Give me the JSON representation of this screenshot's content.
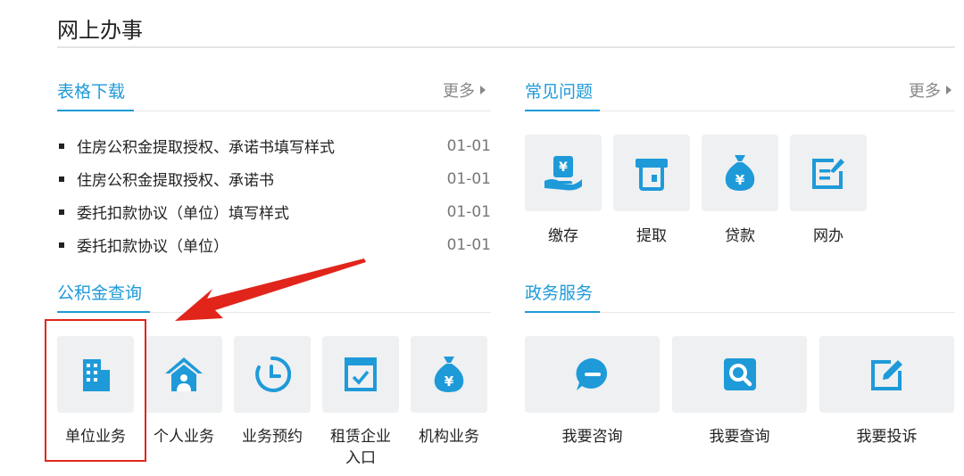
{
  "page": {
    "title": "网上办事"
  },
  "forms": {
    "title": "表格下载",
    "more": "更多",
    "items": [
      {
        "title": "住房公积金提取授权、承诺书填写样式",
        "date": "01-01"
      },
      {
        "title": "住房公积金提取授权、承诺书",
        "date": "01-01"
      },
      {
        "title": "委托扣款协议（单位）填写样式",
        "date": "01-01"
      },
      {
        "title": "委托扣款协议（单位）",
        "date": "01-01"
      }
    ]
  },
  "faq": {
    "title": "常见问题",
    "more": "更多",
    "items": [
      {
        "label": "缴存",
        "icon": "hand-coin-icon"
      },
      {
        "label": "提取",
        "icon": "atm-withdraw-icon"
      },
      {
        "label": "贷款",
        "icon": "money-bag-icon"
      },
      {
        "label": "网办",
        "icon": "online-edit-icon"
      }
    ]
  },
  "query": {
    "title": "公积金查询",
    "items": [
      {
        "label": "单位业务",
        "icon": "building-icon"
      },
      {
        "label": "个人业务",
        "icon": "house-person-icon"
      },
      {
        "label": "业务预约",
        "icon": "clock-icon"
      },
      {
        "label": "租赁企业入口",
        "icon": "checklist-icon"
      },
      {
        "label": "机构业务",
        "icon": "money-bag-icon"
      }
    ]
  },
  "gov": {
    "title": "政务服务",
    "items": [
      {
        "label": "我要咨询",
        "icon": "chat-icon"
      },
      {
        "label": "我要查询",
        "icon": "search-icon"
      },
      {
        "label": "我要投诉",
        "icon": "edit-icon"
      }
    ]
  },
  "colors": {
    "accent": "#1e9ad9",
    "highlight": "#e1251b",
    "tile_bg": "#eef0f1"
  }
}
